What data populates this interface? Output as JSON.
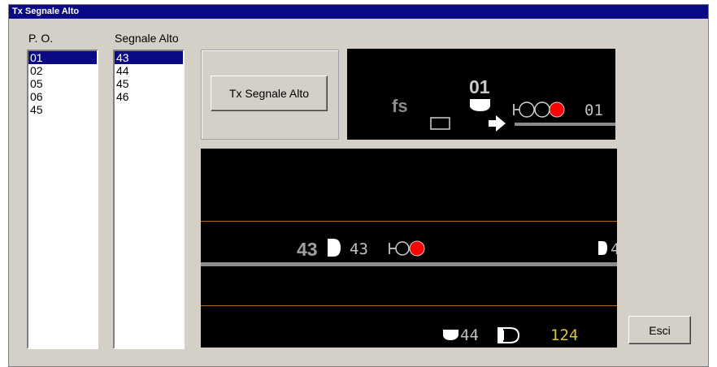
{
  "window": {
    "title": "Tx Segnale Alto"
  },
  "labels": {
    "po": "P. O.",
    "segnale_alto": "Segnale Alto"
  },
  "po_list": {
    "items": [
      {
        "text": "01",
        "selected": true
      },
      {
        "text": "02",
        "selected": false
      },
      {
        "text": "05",
        "selected": false
      },
      {
        "text": "06",
        "selected": false
      },
      {
        "text": "45",
        "selected": false
      }
    ]
  },
  "segnale_list": {
    "items": [
      {
        "text": "43",
        "selected": true
      },
      {
        "text": "44",
        "selected": false
      },
      {
        "text": "45",
        "selected": false
      },
      {
        "text": "46",
        "selected": false
      }
    ]
  },
  "buttons": {
    "tx": "Tx Segnale Alto",
    "esci": "Esci"
  },
  "top_panel": {
    "station_label": "fs",
    "signal_number": "01",
    "signal_id": "01",
    "lamps": [
      "off",
      "off",
      "red"
    ]
  },
  "bottom_panel": {
    "signal_bold": "43",
    "signal_name": "43",
    "signal_lamps": [
      "red"
    ],
    "edge_label": "4",
    "signal_44": "44",
    "counter": "124"
  },
  "colors": {
    "selection": "#0a0a84",
    "lamp_red": "#ff0000",
    "track_gray": "#8c8c8c",
    "text_gray": "#c0c0c0",
    "counter_yellow": "#d9c23a",
    "zone_line_orange": "#b5651d"
  }
}
